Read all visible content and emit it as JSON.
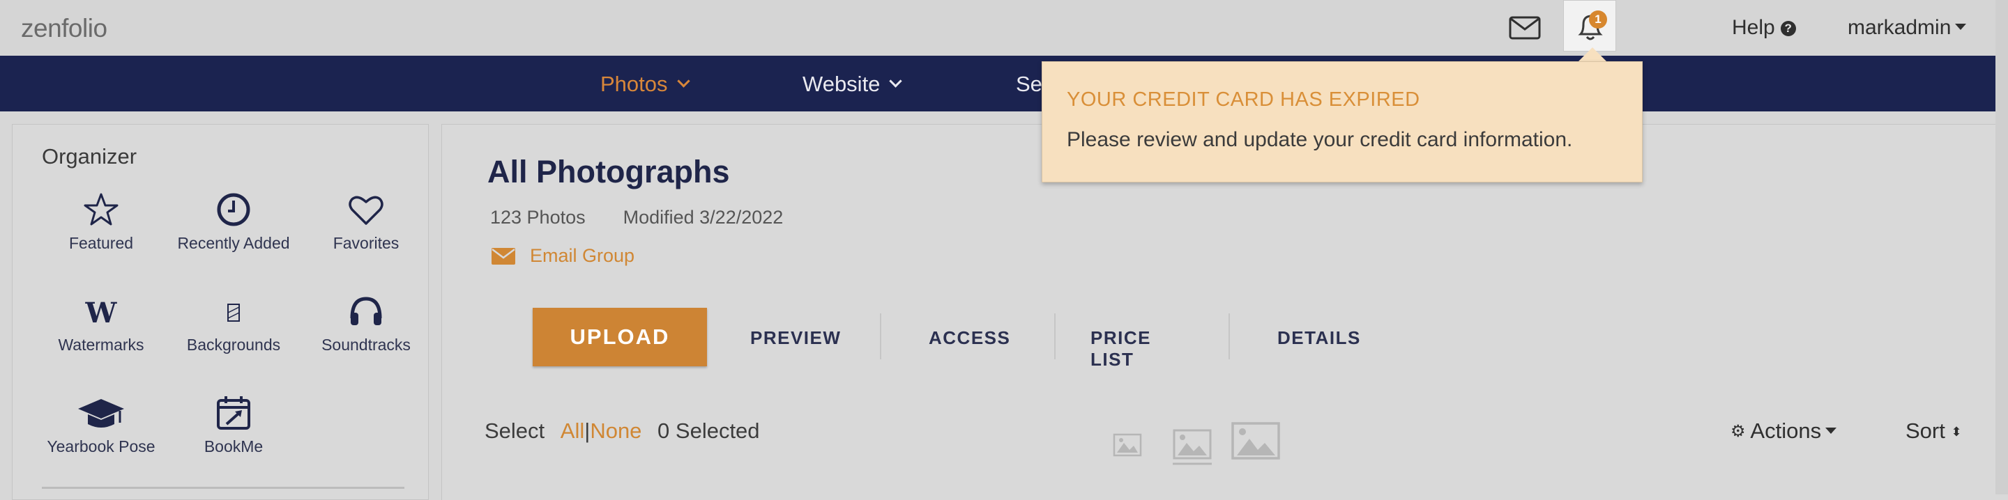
{
  "header": {
    "logo": "zenfolio",
    "notifications_count": "1",
    "help_label": "Help",
    "user_label": "markadmin"
  },
  "nav": {
    "items": [
      {
        "label": "Photos"
      },
      {
        "label": "Website"
      },
      {
        "label": "Se"
      }
    ]
  },
  "sidebar": {
    "title": "Organizer",
    "tiles": [
      {
        "label": "Featured",
        "icon": "star-icon"
      },
      {
        "label": "Recently Added",
        "icon": "clock-icon"
      },
      {
        "label": "Favorites",
        "icon": "heart-icon"
      },
      {
        "label": "Watermarks",
        "icon": "watermark-icon"
      },
      {
        "label": "Backgrounds",
        "icon": "background-icon"
      },
      {
        "label": "Soundtracks",
        "icon": "headphones-icon"
      },
      {
        "label": "Yearbook Pose",
        "icon": "graduation-cap-icon"
      },
      {
        "label": "BookMe",
        "icon": "calendar-icon"
      }
    ]
  },
  "main": {
    "title": "All Photographs",
    "photo_count": "123 Photos",
    "modified": "Modified 3/22/2022",
    "email_group": "Email Group",
    "tabs": {
      "upload": "UPLOAD",
      "preview": "PREVIEW",
      "access": "ACCESS",
      "price_list": "PRICE LIST",
      "details": "DETAILS"
    },
    "select_label": "Select",
    "select_all": "All",
    "select_separator": "|",
    "select_none": "None",
    "selected_count": "0 Selected",
    "actions_label": "Actions",
    "sort_label": "Sort"
  },
  "notification": {
    "title": "YOUR CREDIT CARD HAS EXPIRED",
    "body": "Please review and update your credit card information."
  },
  "colors": {
    "nav_bg": "#1b2350",
    "accent": "#cd8434",
    "popup_bg": "#f7e0bf"
  }
}
